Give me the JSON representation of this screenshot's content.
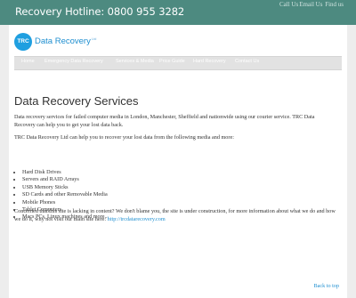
{
  "topbar": {
    "hotline": "Recovery Hotline: 0800 955 3282",
    "links": [
      "Call Us",
      "Email Us",
      "Find us"
    ]
  },
  "logo": {
    "badge": "TRC",
    "name": "Data Recovery",
    "suffix": "Ltd"
  },
  "nav": {
    "items": [
      "Home",
      "Emergency Data Recovery",
      "Services & Media",
      "Price Guide",
      "Hard Recovery",
      "Contact Us"
    ]
  },
  "main": {
    "title": "Data Recovery Services",
    "intro": "Data recovery services for failed computer media in London, Manchester, Sheffield and nationwide using our courier service. TRC Data Recovery can help you to get your lost data back.",
    "lead": "TRC Data Recovery Ltd can help you to recover your lost data from the following media and more:",
    "media": [
      "Hard Disk Drives",
      "Servers and RAID Arrays",
      "USB Memory Sticks",
      "SD Cards and other Removable Media",
      "Mobile Phones",
      "Tablet Computers",
      "Macs PCs, Linux machines and more..."
    ],
    "concern": "Concerned that this site is lacking in content?  We don't blame you, the site is under construction, for more information about what we do and how we do it, why not visit our main site here: ",
    "site_link": "http://trcdatarecovery.com"
  },
  "footer": {
    "back_to_top": "Back to top"
  },
  "colors": {
    "topbar": "#4d8a80",
    "link": "#1f8fd0",
    "background": "#ededed"
  }
}
